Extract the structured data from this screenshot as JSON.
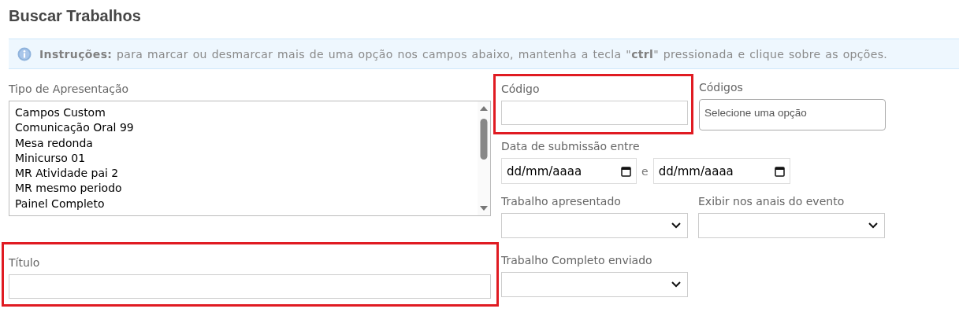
{
  "title": "Buscar Trabalhos",
  "instructions": {
    "lead": "Instruções:",
    "text": "para marcar ou desmarcar mais de uma opção nos campos abaixo, mantenha a tecla \"**ctrl**\" pressionada e clique sobre as opções."
  },
  "tipo_apresentacao": {
    "label": "Tipo de Apresentação",
    "options": [
      "Campos Custom",
      "Comunicação Oral 99",
      "Mesa redonda",
      "Minicurso 01",
      "MR Atividade pai 2",
      "MR mesmo periodo",
      "Painel Completo"
    ]
  },
  "titulo": {
    "label": "Título",
    "highlighted": true
  },
  "codigo": {
    "label": "Código",
    "highlighted": true
  },
  "codigos": {
    "label": "Códigos",
    "placeholder": "Selecione uma opção"
  },
  "data_submissao": {
    "label": "Data de submissão entre",
    "from_placeholder": "dd/mm/aaaa",
    "separator": "e",
    "to_placeholder": "dd/mm/aaaa"
  },
  "trabalho_apresentado": {
    "label": "Trabalho apresentado"
  },
  "exibir_anais": {
    "label": "Exibir nos anais do evento"
  },
  "trabalho_completo": {
    "label": "Trabalho Completo enviado"
  }
}
